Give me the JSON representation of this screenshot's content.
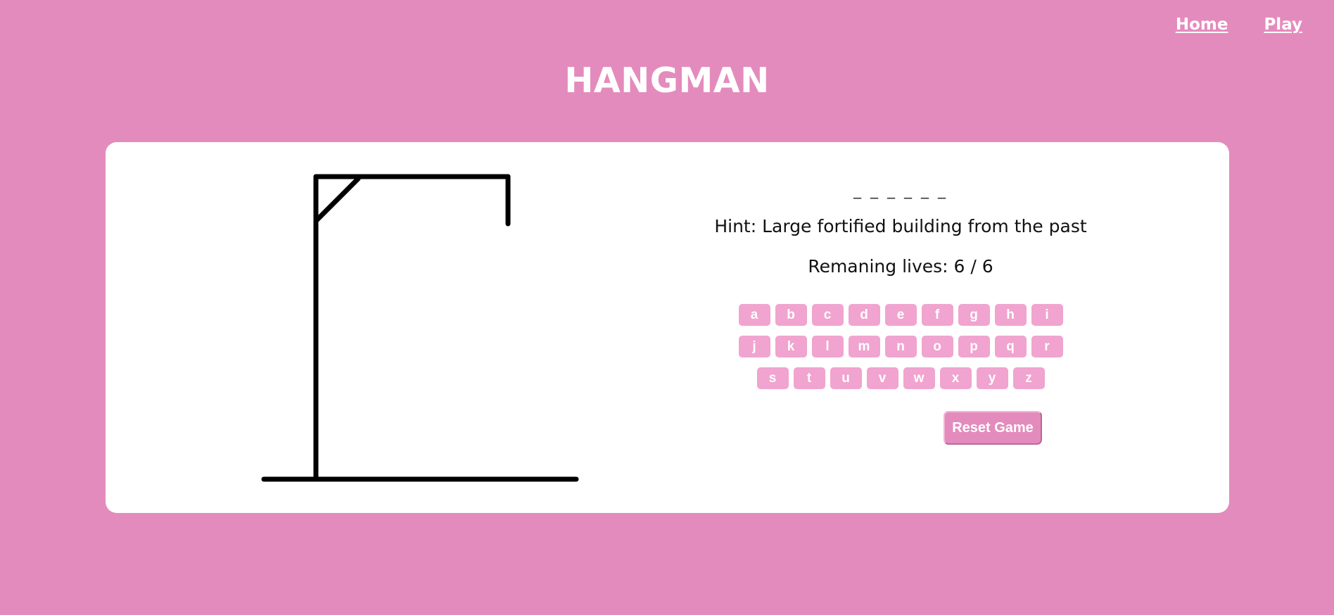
{
  "nav": {
    "home": "Home",
    "play": "Play"
  },
  "title": "HANGMAN",
  "game": {
    "word_display": "_ _ _ _ _ _",
    "hint": "Hint: Large fortified building from the past",
    "lives": "Remaning lives: 6 / 6",
    "lives_remaining": 6,
    "lives_total": 6,
    "keyboard_rows": [
      [
        "a",
        "b",
        "c",
        "d",
        "e",
        "f",
        "g",
        "h",
        "i"
      ],
      [
        "j",
        "k",
        "l",
        "m",
        "n",
        "o",
        "p",
        "q",
        "r"
      ],
      [
        "s",
        "t",
        "u",
        "v",
        "w",
        "x",
        "y",
        "z"
      ]
    ],
    "reset_label": "Reset Game"
  },
  "colors": {
    "background": "#e48bbd",
    "card": "#ffffff",
    "key": "#f0a4cf",
    "ink": "#000000"
  }
}
